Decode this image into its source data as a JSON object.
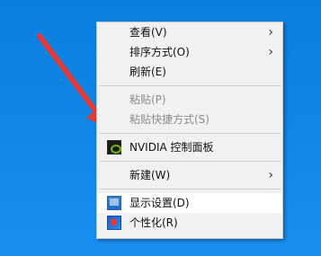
{
  "desktop": {
    "background_color": "#0f84e4"
  },
  "arrow": {
    "color": "#e53935"
  },
  "context_menu": {
    "items": [
      {
        "label": "查看(V)",
        "has_submenu": true,
        "disabled": false
      },
      {
        "label": "排序方式(O)",
        "has_submenu": true,
        "disabled": false
      },
      {
        "label": "刷新(E)",
        "has_submenu": false,
        "disabled": false
      },
      {
        "label": "粘贴(P)",
        "has_submenu": false,
        "disabled": true
      },
      {
        "label": "粘贴快捷方式(S)",
        "has_submenu": false,
        "disabled": true
      },
      {
        "label": "NVIDIA 控制面板",
        "has_submenu": false,
        "disabled": false,
        "icon": "nvidia-icon"
      },
      {
        "label": "新建(W)",
        "has_submenu": true,
        "disabled": false
      },
      {
        "label": "显示设置(D)",
        "has_submenu": false,
        "disabled": false,
        "icon": "display-settings-icon",
        "highlighted": true
      },
      {
        "label": "个性化(R)",
        "has_submenu": false,
        "disabled": false,
        "icon": "personalize-icon"
      }
    ],
    "submenu_chevron": "›"
  }
}
